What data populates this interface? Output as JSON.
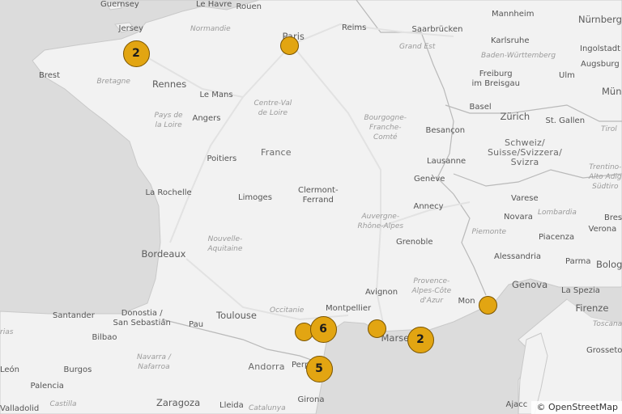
{
  "map": {
    "attribution": "© OpenStreetMap",
    "colors": {
      "land": "#f2f2f2",
      "sea": "#dcdcdc",
      "border": "#b8b8b8",
      "marker_fill": "#e2a512",
      "marker_stroke": "#7a5400"
    },
    "labels": [
      {
        "id": "guernsey",
        "text": "Guernsey",
        "kind": "city"
      },
      {
        "id": "jersey",
        "text": "Jersey",
        "kind": "city"
      },
      {
        "id": "le-havre",
        "text": "Le Havre",
        "kind": "city"
      },
      {
        "id": "rouen",
        "text": "Rouen",
        "kind": "city"
      },
      {
        "id": "normandie",
        "text": "Normandie",
        "kind": "region"
      },
      {
        "id": "paris",
        "text": "Paris",
        "kind": "big"
      },
      {
        "id": "reims",
        "text": "Reims",
        "kind": "city"
      },
      {
        "id": "grand-est",
        "text": "Grand Est",
        "kind": "region"
      },
      {
        "id": "saarbrucken",
        "text": "Saarbrücken",
        "kind": "city"
      },
      {
        "id": "mannheim",
        "text": "Mannheim",
        "kind": "city"
      },
      {
        "id": "nurnberg",
        "text": "Nürnberg",
        "kind": "big"
      },
      {
        "id": "karlsruhe",
        "text": "Karlsruhe",
        "kind": "city"
      },
      {
        "id": "ingolstadt",
        "text": "Ingolstadt",
        "kind": "city"
      },
      {
        "id": "baden",
        "text": "Baden-Württemberg",
        "kind": "region"
      },
      {
        "id": "augsburg",
        "text": "Augsburg",
        "kind": "city"
      },
      {
        "id": "brest",
        "text": "Brest",
        "kind": "city"
      },
      {
        "id": "bretagne",
        "text": "Bretagne",
        "kind": "region"
      },
      {
        "id": "rennes",
        "text": "Rennes",
        "kind": "big"
      },
      {
        "id": "freiburg",
        "text": "Freiburg\nim Breisgau",
        "kind": "city"
      },
      {
        "id": "ulm",
        "text": "Ulm",
        "kind": "city"
      },
      {
        "id": "mun",
        "text": "Mün",
        "kind": "big"
      },
      {
        "id": "le-mans",
        "text": "Le Mans",
        "kind": "city"
      },
      {
        "id": "centre",
        "text": "Centre-Val\nde Loire",
        "kind": "region"
      },
      {
        "id": "basel",
        "text": "Basel",
        "kind": "city"
      },
      {
        "id": "angers",
        "text": "Angers",
        "kind": "city"
      },
      {
        "id": "pays-loire",
        "text": "Pays de\nla Loire",
        "kind": "region"
      },
      {
        "id": "bourgogne",
        "text": "Bourgogne-\nFranche-\nComté",
        "kind": "region"
      },
      {
        "id": "besancon",
        "text": "Besançon",
        "kind": "city"
      },
      {
        "id": "zurich",
        "text": "Zürich",
        "kind": "big"
      },
      {
        "id": "st-gallen",
        "text": "St. Gallen",
        "kind": "city"
      },
      {
        "id": "tirol",
        "text": "Tirol",
        "kind": "region"
      },
      {
        "id": "france",
        "text": "France",
        "kind": "country"
      },
      {
        "id": "schweiz",
        "text": "Schweiz/\nSuisse/Svizzera/\nSvizra",
        "kind": "country"
      },
      {
        "id": "poitiers",
        "text": "Poitiers",
        "kind": "city"
      },
      {
        "id": "lausanne",
        "text": "Lausanne",
        "kind": "city"
      },
      {
        "id": "trentino",
        "text": "Trentino-\nAlto Adig\nSüdtiro",
        "kind": "region"
      },
      {
        "id": "geneve",
        "text": "Genève",
        "kind": "city"
      },
      {
        "id": "la-rochelle",
        "text": "La Rochelle",
        "kind": "city"
      },
      {
        "id": "limoges",
        "text": "Limoges",
        "kind": "city"
      },
      {
        "id": "clermont",
        "text": "Clermont-\nFerrand",
        "kind": "city"
      },
      {
        "id": "annecy",
        "text": "Annecy",
        "kind": "city"
      },
      {
        "id": "varese",
        "text": "Varese",
        "kind": "city"
      },
      {
        "id": "auvergne",
        "text": "Auvergne-\nRhône-Alpes",
        "kind": "region"
      },
      {
        "id": "lombardia",
        "text": "Lombardia",
        "kind": "region"
      },
      {
        "id": "novara",
        "text": "Novara",
        "kind": "city"
      },
      {
        "id": "brescia",
        "text": "Bres",
        "kind": "city"
      },
      {
        "id": "grenoble",
        "text": "Grenoble",
        "kind": "city"
      },
      {
        "id": "piemonte",
        "text": "Piemonte",
        "kind": "region"
      },
      {
        "id": "verona",
        "text": "Verona",
        "kind": "city"
      },
      {
        "id": "nouvelle",
        "text": "Nouvelle-\nAquitaine",
        "kind": "region"
      },
      {
        "id": "piacenza",
        "text": "Piacenza",
        "kind": "city"
      },
      {
        "id": "bordeaux",
        "text": "Bordeaux",
        "kind": "big"
      },
      {
        "id": "alessandria",
        "text": "Alessandria",
        "kind": "city"
      },
      {
        "id": "parma",
        "text": "Parma",
        "kind": "city"
      },
      {
        "id": "bologna",
        "text": "Bolog",
        "kind": "big"
      },
      {
        "id": "provence",
        "text": "Provence-\nAlpes-Côte\nd'Azur",
        "kind": "region"
      },
      {
        "id": "genova",
        "text": "Genova",
        "kind": "big"
      },
      {
        "id": "avignon",
        "text": "Avignon",
        "kind": "city"
      },
      {
        "id": "la-spezia",
        "text": "La Spezia",
        "kind": "city"
      },
      {
        "id": "santander",
        "text": "Santander",
        "kind": "city"
      },
      {
        "id": "donostia",
        "text": "Donostia /\nSan Sebastián",
        "kind": "city"
      },
      {
        "id": "toulouse",
        "text": "Toulouse",
        "kind": "big"
      },
      {
        "id": "occitanie",
        "text": "Occitanie",
        "kind": "region"
      },
      {
        "id": "montpellier",
        "text": "Montpellier",
        "kind": "city"
      },
      {
        "id": "monaco",
        "text": "Mon",
        "kind": "city"
      },
      {
        "id": "firenze",
        "text": "Firenze",
        "kind": "big"
      },
      {
        "id": "asturias",
        "text": "rias",
        "kind": "region"
      },
      {
        "id": "bilbao",
        "text": "Bilbao",
        "kind": "city"
      },
      {
        "id": "pau",
        "text": "Pau",
        "kind": "city"
      },
      {
        "id": "marseille",
        "text": "Marse",
        "kind": "big"
      },
      {
        "id": "toscana",
        "text": "Toscana",
        "kind": "region"
      },
      {
        "id": "grosseto",
        "text": "Grosseto",
        "kind": "city"
      },
      {
        "id": "navarra",
        "text": "Navarra /\nNafarroa",
        "kind": "region"
      },
      {
        "id": "leon",
        "text": "León",
        "kind": "city"
      },
      {
        "id": "burgos",
        "text": "Burgos",
        "kind": "city"
      },
      {
        "id": "andorra",
        "text": "Andorra",
        "kind": "country"
      },
      {
        "id": "perpignan",
        "text": "Perp",
        "kind": "city"
      },
      {
        "id": "palencia",
        "text": "Palencia",
        "kind": "city"
      },
      {
        "id": "castilla",
        "text": "Castilla",
        "kind": "region"
      },
      {
        "id": "zaragoza",
        "text": "Zaragoza",
        "kind": "big"
      },
      {
        "id": "lleida",
        "text": "Lleida",
        "kind": "city"
      },
      {
        "id": "girona",
        "text": "Girona",
        "kind": "city"
      },
      {
        "id": "catalunya",
        "text": "Catalunya",
        "kind": "region"
      },
      {
        "id": "valladolid",
        "text": "Valladolid",
        "kind": "city"
      },
      {
        "id": "ajaccio",
        "text": "Ajacc",
        "kind": "city"
      }
    ],
    "markers": [
      {
        "id": "brittany",
        "count": "2"
      },
      {
        "id": "paris",
        "count": ""
      },
      {
        "id": "perpignan-north",
        "count": ""
      },
      {
        "id": "narbonne",
        "count": "6"
      },
      {
        "id": "perpignan",
        "count": "5"
      },
      {
        "id": "marseille-west",
        "count": ""
      },
      {
        "id": "marseille",
        "count": "2"
      },
      {
        "id": "monaco",
        "count": ""
      }
    ]
  }
}
